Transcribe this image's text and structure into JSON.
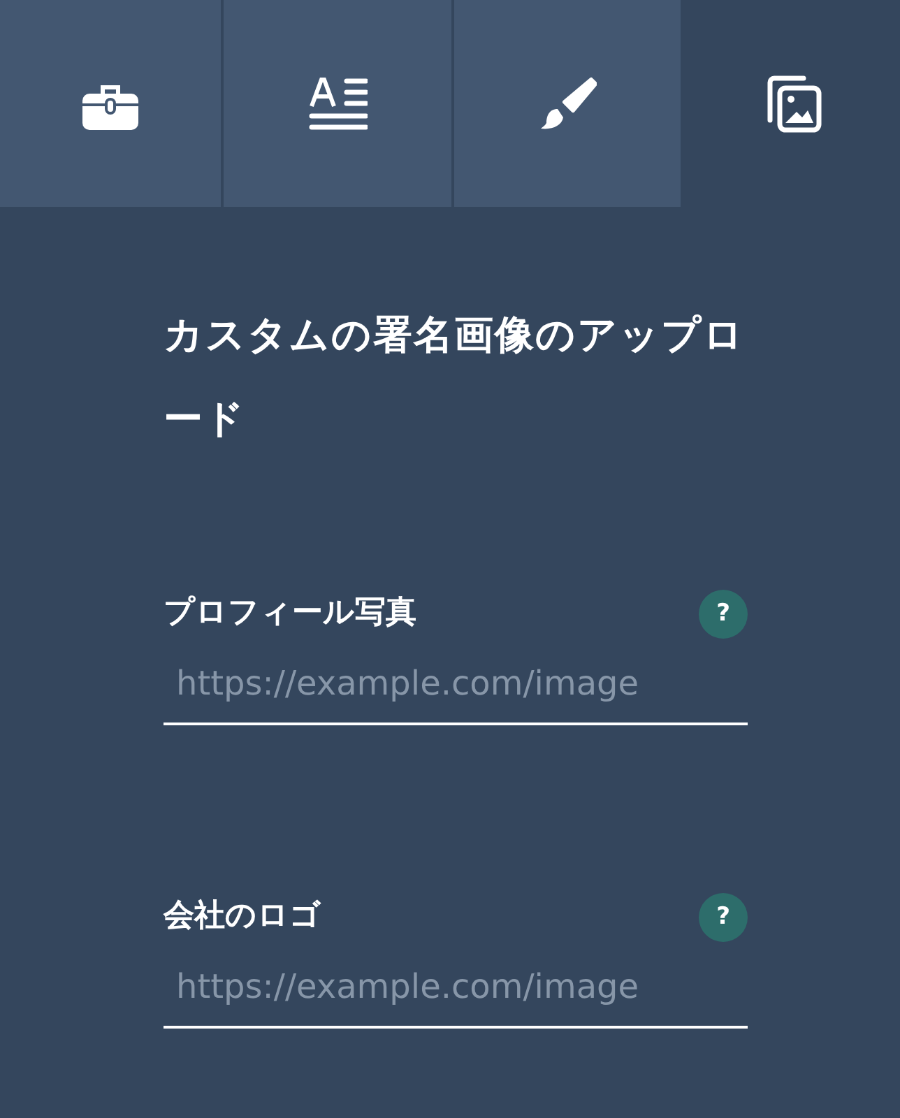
{
  "tabs": [
    {
      "kind": "toolbox",
      "selected": false
    },
    {
      "kind": "text",
      "selected": false
    },
    {
      "kind": "brush",
      "selected": false
    },
    {
      "kind": "images",
      "selected": true
    }
  ],
  "heading": "カスタムの署名画像のアップロード",
  "fields": [
    {
      "label": "プロフィール写真",
      "help": "?",
      "placeholder": "https://example.com/image"
    },
    {
      "label": "会社のロゴ",
      "help": "?",
      "placeholder": "https://example.com/image"
    }
  ]
}
